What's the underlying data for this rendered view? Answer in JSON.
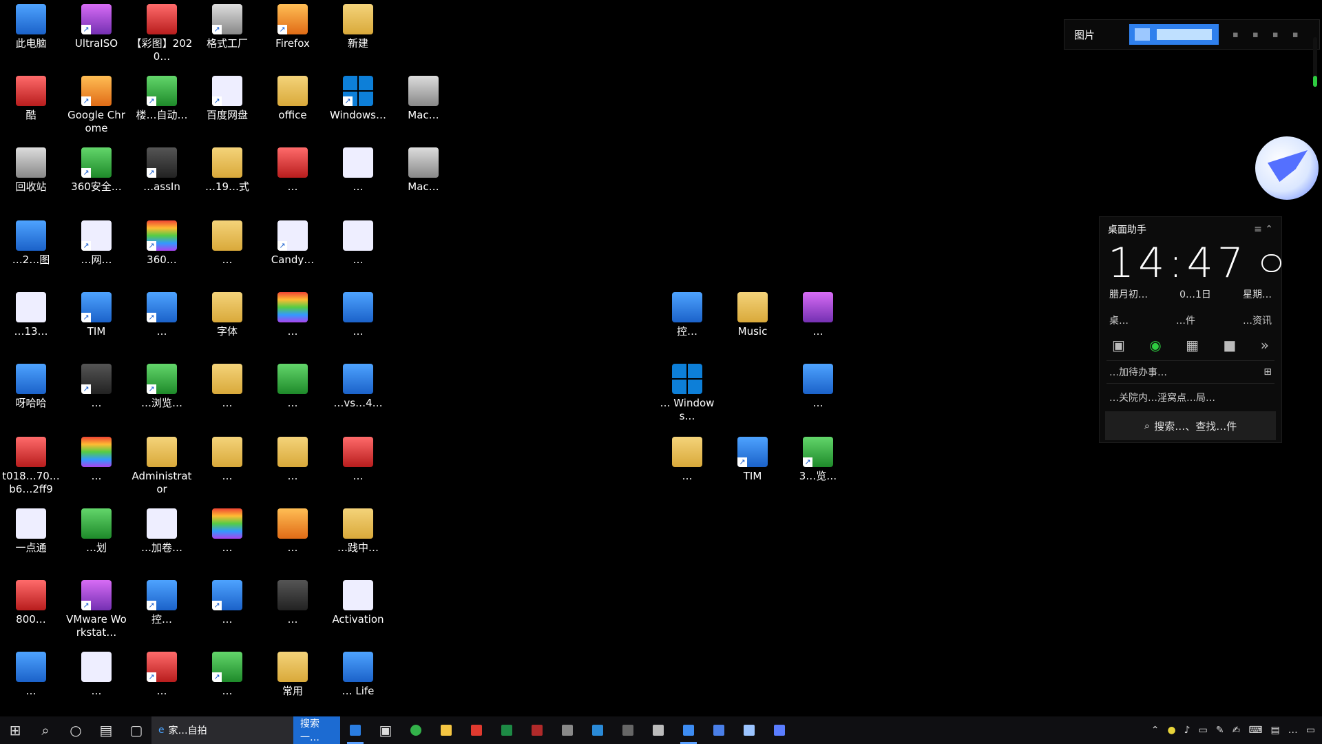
{
  "desktop": {
    "icons": [
      {
        "id": "c0r0",
        "label": "此电脑",
        "style": "blue",
        "shortcut": false
      },
      {
        "id": "c1r0",
        "label": "UltraISO",
        "style": "purple",
        "shortcut": true
      },
      {
        "id": "c2r0",
        "label": "【彩图】2020…",
        "style": "red",
        "shortcut": false
      },
      {
        "id": "c3r0",
        "label": "格式工厂",
        "style": "gray",
        "shortcut": true
      },
      {
        "id": "c4r0",
        "label": "Firefox",
        "style": "orange",
        "shortcut": true
      },
      {
        "id": "c5r0",
        "label": "新建",
        "style": "folder",
        "shortcut": false
      },
      {
        "id": "c0r1",
        "label": "酷",
        "style": "red",
        "shortcut": false
      },
      {
        "id": "c1r1",
        "label": "Google Chrome",
        "style": "orange",
        "shortcut": true
      },
      {
        "id": "c2r1",
        "label": "楼…自动…",
        "style": "green",
        "shortcut": true
      },
      {
        "id": "c3r1",
        "label": "百度网盘",
        "style": "white",
        "shortcut": true
      },
      {
        "id": "c4r1",
        "label": "office",
        "style": "folder",
        "shortcut": false
      },
      {
        "id": "c5r1",
        "label": "Windows…",
        "style": "win",
        "shortcut": true
      },
      {
        "id": "c6r1",
        "label": "Mac…",
        "style": "gray",
        "shortcut": false
      },
      {
        "id": "c0r2",
        "label": "回收站",
        "style": "gray",
        "shortcut": false
      },
      {
        "id": "c1r2",
        "label": "360安全…",
        "style": "green",
        "shortcut": true
      },
      {
        "id": "c2r2",
        "label": "…assIn",
        "style": "dark",
        "shortcut": true
      },
      {
        "id": "c3r2",
        "label": "…19…式",
        "style": "folder",
        "shortcut": false
      },
      {
        "id": "c4r2",
        "label": "…",
        "style": "red",
        "shortcut": false
      },
      {
        "id": "c5r2",
        "label": "…",
        "style": "white",
        "shortcut": false
      },
      {
        "id": "c6r2",
        "label": "Mac…",
        "style": "gray",
        "shortcut": false
      },
      {
        "id": "c0r3",
        "label": "…2…图",
        "style": "blue",
        "shortcut": false
      },
      {
        "id": "c1r3",
        "label": "…网…",
        "style": "white",
        "shortcut": true
      },
      {
        "id": "c2r3",
        "label": "360…",
        "style": "rainbow",
        "shortcut": true
      },
      {
        "id": "c3r3",
        "label": "…",
        "style": "folder",
        "shortcut": false
      },
      {
        "id": "c4r3",
        "label": "Candy…",
        "style": "white",
        "shortcut": true
      },
      {
        "id": "c5r3",
        "label": "…",
        "style": "white",
        "shortcut": false
      },
      {
        "id": "c0r4",
        "label": "…13…",
        "style": "white",
        "shortcut": false
      },
      {
        "id": "c1r4",
        "label": "TIM",
        "style": "blue",
        "shortcut": true
      },
      {
        "id": "c2r4",
        "label": "…",
        "style": "blue",
        "shortcut": true
      },
      {
        "id": "c3r4",
        "label": "字体",
        "style": "folder",
        "shortcut": false
      },
      {
        "id": "c4r4",
        "label": "…",
        "style": "rainbow",
        "shortcut": false
      },
      {
        "id": "c5r4",
        "label": "…",
        "style": "blue",
        "shortcut": false
      },
      {
        "id": "c0r5",
        "label": "呀哈哈",
        "style": "blue",
        "shortcut": false
      },
      {
        "id": "c1r5",
        "label": "…",
        "style": "dark",
        "shortcut": true
      },
      {
        "id": "c2r5",
        "label": "…浏览…",
        "style": "green",
        "shortcut": true
      },
      {
        "id": "c3r5",
        "label": "…",
        "style": "folder",
        "shortcut": false
      },
      {
        "id": "c4r5",
        "label": "…",
        "style": "green",
        "shortcut": false
      },
      {
        "id": "c5r5",
        "label": "…vs…4…",
        "style": "blue",
        "shortcut": false
      },
      {
        "id": "c0r6",
        "label": "t018…70…b6…2ff9",
        "style": "red",
        "shortcut": false
      },
      {
        "id": "c1r6",
        "label": "…",
        "style": "rainbow",
        "shortcut": false
      },
      {
        "id": "c2r6",
        "label": "Administrator",
        "style": "folder",
        "shortcut": false
      },
      {
        "id": "c3r6",
        "label": "…",
        "style": "folder",
        "shortcut": false
      },
      {
        "id": "c4r6",
        "label": "…",
        "style": "folder",
        "shortcut": false
      },
      {
        "id": "c5r6",
        "label": "…",
        "style": "red",
        "shortcut": false
      },
      {
        "id": "c0r7",
        "label": "一点通",
        "style": "white",
        "shortcut": false
      },
      {
        "id": "c1r7",
        "label": "…划",
        "style": "green",
        "shortcut": false
      },
      {
        "id": "c2r7",
        "label": "…加卷…",
        "style": "white",
        "shortcut": false
      },
      {
        "id": "c3r7",
        "label": "…",
        "style": "rainbow",
        "shortcut": false
      },
      {
        "id": "c4r7",
        "label": "…",
        "style": "orange",
        "shortcut": false
      },
      {
        "id": "c5r7",
        "label": "…践中…",
        "style": "folder",
        "shortcut": false
      },
      {
        "id": "c0r8",
        "label": "800…",
        "style": "red",
        "shortcut": false
      },
      {
        "id": "c1r8",
        "label": "VMware Workstat…",
        "style": "purple",
        "shortcut": true
      },
      {
        "id": "c2r8",
        "label": "控…",
        "style": "blue",
        "shortcut": true
      },
      {
        "id": "c3r8",
        "label": "…",
        "style": "blue",
        "shortcut": true
      },
      {
        "id": "c4r8",
        "label": "…",
        "style": "dark",
        "shortcut": false
      },
      {
        "id": "c5r8",
        "label": "Activation",
        "style": "white",
        "shortcut": false
      },
      {
        "id": "c0r9",
        "label": "…",
        "style": "blue",
        "shortcut": false
      },
      {
        "id": "c1r9",
        "label": "…",
        "style": "white",
        "shortcut": false
      },
      {
        "id": "c2r9",
        "label": "…",
        "style": "red",
        "shortcut": true
      },
      {
        "id": "c3r9",
        "label": "…",
        "style": "green",
        "shortcut": true
      },
      {
        "id": "c4r9",
        "label": "常用",
        "style": "folder",
        "shortcut": false
      },
      {
        "id": "c5r9",
        "label": "… Life",
        "style": "blue",
        "shortcut": false
      },
      {
        "id": "m0r4",
        "label": "控…",
        "style": "blue",
        "shortcut": false
      },
      {
        "id": "m1r4",
        "label": "Music",
        "style": "folder",
        "shortcut": false
      },
      {
        "id": "m2r4",
        "label": "…",
        "style": "purple",
        "shortcut": false
      },
      {
        "id": "m0r5",
        "label": "… Windows…",
        "style": "win",
        "shortcut": false
      },
      {
        "id": "m2r5",
        "label": "…",
        "style": "blue",
        "shortcut": false
      },
      {
        "id": "m0r6",
        "label": "…",
        "style": "folder",
        "shortcut": false
      },
      {
        "id": "m1r6",
        "label": "TIM",
        "style": "blue",
        "shortcut": true
      },
      {
        "id": "m2r6",
        "label": "3…览…",
        "style": "green",
        "shortcut": true
      }
    ]
  },
  "image_bar": {
    "label": "图片"
  },
  "assistant": {
    "title": "桌面助手",
    "time": "14:47",
    "lunar": "腊月初…",
    "date": "0…1日",
    "weekday": "星期…",
    "shortcuts": [
      "桌…",
      "…件",
      "…资讯"
    ],
    "todo": "…加待办事…",
    "news": "…关院内…淫窝点…局…",
    "search": "搜索…、查找…件"
  },
  "taskbar": {
    "app1": "家…自拍",
    "app2": "搜索一…",
    "tray_time": "…"
  },
  "colors": {
    "accent": "#2f80ed",
    "taskbar": "#0f0f12"
  }
}
